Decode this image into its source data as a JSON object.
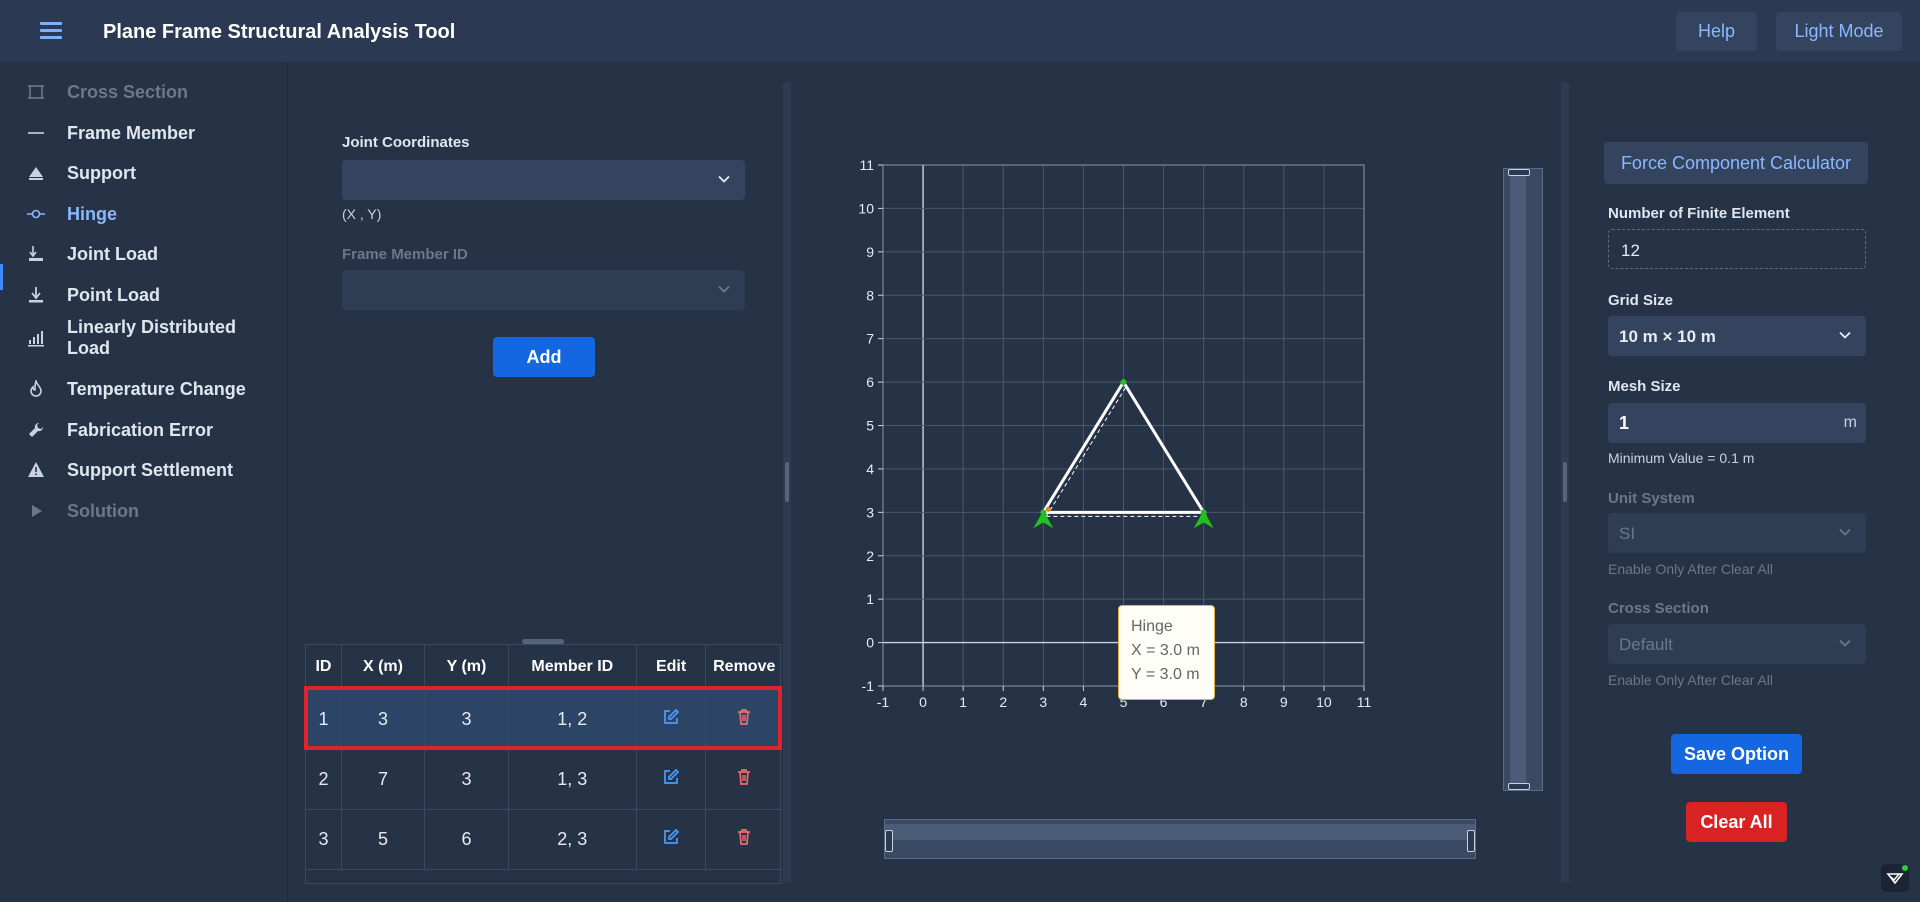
{
  "header": {
    "title": "Plane Frame Structural Analysis Tool",
    "help_label": "Help",
    "mode_label": "Light Mode"
  },
  "sidebar": {
    "items": [
      {
        "label": "Cross Section",
        "icon": "cross-section-icon",
        "state": "disabled"
      },
      {
        "label": "Frame Member",
        "icon": "line-icon",
        "state": "normal"
      },
      {
        "label": "Support",
        "icon": "support-icon",
        "state": "normal"
      },
      {
        "label": "Hinge",
        "icon": "hinge-icon",
        "state": "active"
      },
      {
        "label": "Joint Load",
        "icon": "joint-load-icon",
        "state": "normal"
      },
      {
        "label": "Point Load",
        "icon": "point-load-icon",
        "state": "normal"
      },
      {
        "label": "Linearly Distributed Load",
        "icon": "distributed-load-icon",
        "state": "normal"
      },
      {
        "label": "Temperature Change",
        "icon": "flame-icon",
        "state": "normal"
      },
      {
        "label": "Fabrication Error",
        "icon": "wrench-icon",
        "state": "normal"
      },
      {
        "label": "Support Settlement",
        "icon": "warning-icon",
        "state": "normal"
      },
      {
        "label": "Solution",
        "icon": "play-icon",
        "state": "disabled"
      }
    ]
  },
  "form": {
    "joint_label": "Joint Coordinates",
    "joint_value": "",
    "joint_hint": "(X , Y)",
    "member_label": "Frame Member ID",
    "member_value": "",
    "add_label": "Add"
  },
  "table": {
    "headers": [
      "ID",
      "X (m)",
      "Y (m)",
      "Member ID",
      "Edit",
      "Remove"
    ],
    "rows": [
      {
        "id": "1",
        "x": "3",
        "y": "3",
        "members": "1, 2",
        "selected": true
      },
      {
        "id": "2",
        "x": "7",
        "y": "3",
        "members": "1, 3",
        "selected": false
      },
      {
        "id": "3",
        "x": "5",
        "y": "6",
        "members": "2, 3",
        "selected": false
      }
    ]
  },
  "plot": {
    "x_ticks": [
      "-1",
      "0",
      "1",
      "2",
      "3",
      "4",
      "5",
      "6",
      "7",
      "8",
      "9",
      "10",
      "11"
    ],
    "y_ticks": [
      "-1",
      "0",
      "1",
      "2",
      "3",
      "4",
      "5",
      "6",
      "7",
      "8",
      "9",
      "10",
      "11"
    ],
    "xlim": [
      -1,
      11
    ],
    "ylim": [
      -1,
      11
    ],
    "members": [
      {
        "from": [
          3,
          3
        ],
        "to": [
          7,
          3
        ]
      },
      {
        "from": [
          3,
          3
        ],
        "to": [
          5,
          6
        ]
      },
      {
        "from": [
          7,
          3
        ],
        "to": [
          5,
          6
        ]
      }
    ],
    "supports": [
      [
        3,
        3
      ],
      [
        7,
        3
      ]
    ],
    "hinges": [
      [
        3,
        3
      ],
      [
        7,
        3
      ],
      [
        5,
        6
      ]
    ],
    "tooltip": {
      "title": "Hinge",
      "x_text": "X = 3.0 m",
      "y_text": "Y = 3.0 m"
    }
  },
  "settings": {
    "fcc_label": "Force Component Calculator",
    "fe_label": "Number of Finite Element",
    "fe_value": "12",
    "grid_label": "Grid Size",
    "grid_value": "10 m × 10 m",
    "mesh_label": "Mesh Size",
    "mesh_value": "1",
    "mesh_unit": "m",
    "mesh_hint": "Minimum Value = 0.1 m",
    "unit_label": "Unit System",
    "unit_value": "SI",
    "unit_hint": "Enable Only After Clear All",
    "cs_label": "Cross Section",
    "cs_value": "Default",
    "cs_hint": "Enable Only After Clear All",
    "save_label": "Save Option",
    "clear_label": "Clear All"
  },
  "colors": {
    "accent": "#1467e0",
    "danger": "#d92323",
    "highlight": "#e0242e",
    "support": "#22c21e"
  }
}
